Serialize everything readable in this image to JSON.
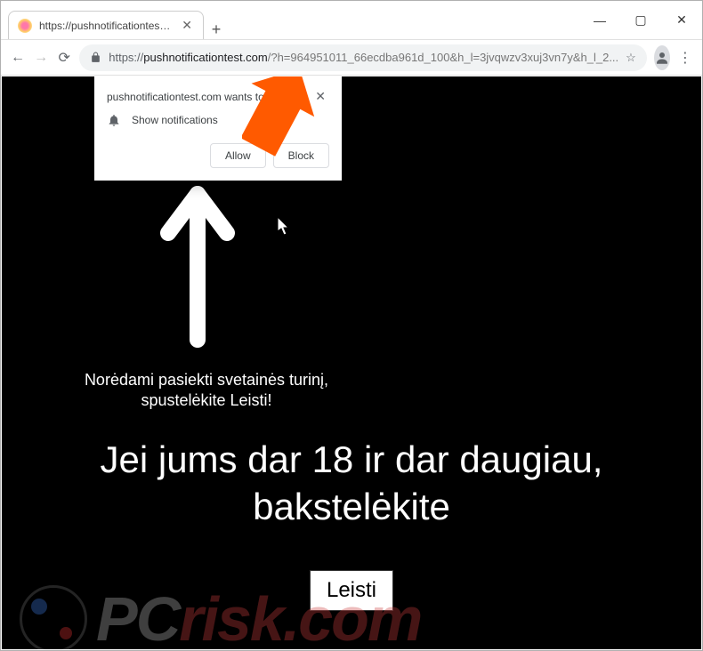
{
  "window": {
    "tab_title": "https://pushnotificationtest.com/",
    "new_tab_glyph": "+",
    "min_glyph": "—",
    "max_glyph": "▢",
    "close_glyph": "✕"
  },
  "toolbar": {
    "back_glyph": "←",
    "fwd_glyph": "→",
    "reload_glyph": "⟳",
    "url_scheme": "https://",
    "url_host": "pushnotificationtest.com",
    "url_rest": "/?h=964951011_66ecdba961d_100&h_l=3jvqwzv3xuj3vn7y&h_l_2...",
    "star_glyph": "☆",
    "menu_glyph": "⋮"
  },
  "permission": {
    "origin_text": "pushnotificationtest.com wants to",
    "body_text": "Show notifications",
    "allow_label": "Allow",
    "block_label": "Block",
    "close_glyph": "✕"
  },
  "page": {
    "subtitle": "Norėdami pasiekti svetainės turinį, spustelėkite Leisti!",
    "headline": "Jei jums dar 18 ir dar daugiau, bakstelėkite",
    "allow_button": "Leisti"
  },
  "watermark": {
    "part1": "PC",
    "part2": "risk.com"
  },
  "colors": {
    "accent_arrow": "#ff5a00",
    "page_bg": "#000000"
  }
}
